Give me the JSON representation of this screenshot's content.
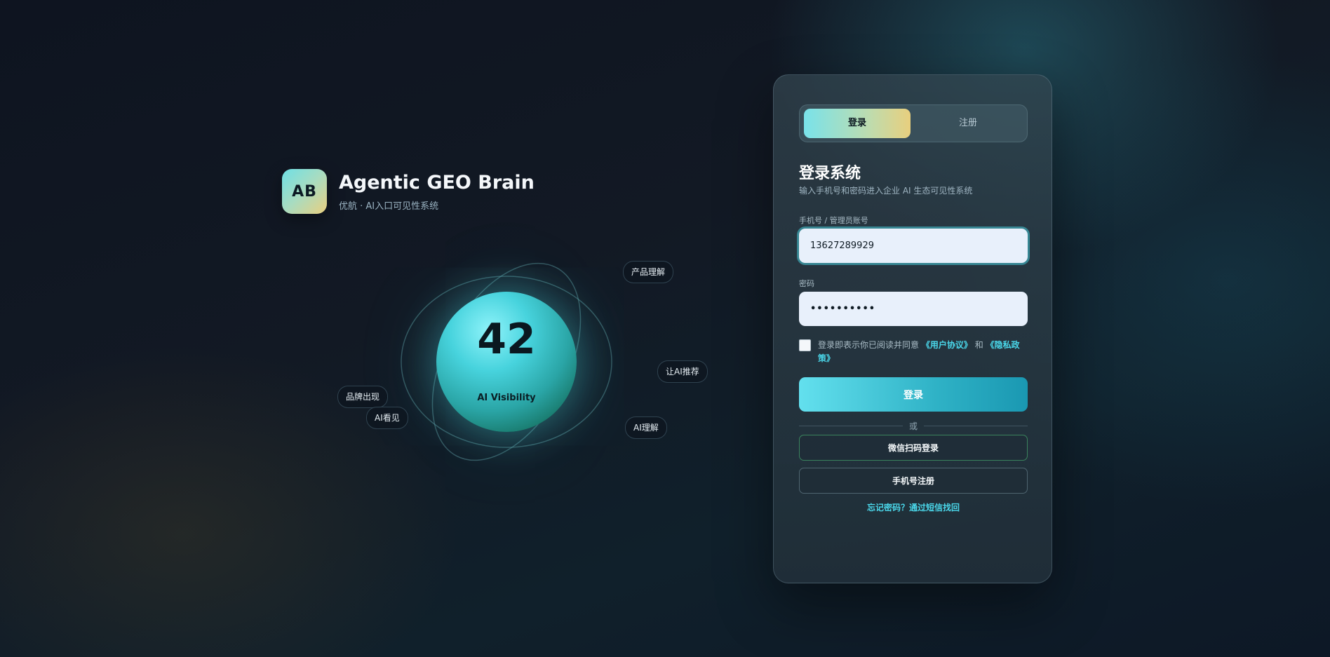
{
  "brand": {
    "logo_text": "AB",
    "title": "Agentic GEO Brain",
    "subtitle": "优航 · AI入口可见性系统"
  },
  "orb": {
    "score": "42",
    "label": "AI Visibility",
    "chips": [
      "产品理解",
      "让AI推荐",
      "AI理解",
      "品牌出现",
      "AI看见"
    ]
  },
  "tabs": {
    "login": "登录",
    "register": "注册",
    "active": "login"
  },
  "login": {
    "title": "登录系统",
    "subtitle": "输入手机号和密码进入企业 AI 生态可见性系统",
    "phone_label": "手机号 / 管理员账号",
    "phone_value": "13627289929",
    "password_label": "密码",
    "password_value": "••••••••••",
    "agree_prefix": "登录即表示你已阅读并同意",
    "agree_user": "《用户协议》",
    "agree_and": "和",
    "agree_privacy": "《隐私政策》",
    "agree_checked": false,
    "submit": "登录",
    "or": "或",
    "wechat": "微信扫码登录",
    "phone_register": "手机号注册",
    "forgot": "忘记密码？通过短信找回"
  },
  "colors": {
    "accent_cyan": "#4ad7ea",
    "accent_gold": "#e8cf7e",
    "card_bg": "#2a3a44",
    "input_bg": "#e8f0fb"
  }
}
